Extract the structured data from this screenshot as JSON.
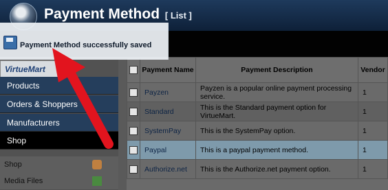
{
  "header": {
    "title": "Payment Method",
    "subtitle": "[ List ]"
  },
  "notification": {
    "message": "Payment Method successfully saved",
    "icon": "floppy-disk-icon"
  },
  "brand": {
    "logo_text": "VirtueMart"
  },
  "sidebar": {
    "menu": [
      "Products",
      "Orders & Shoppers",
      "Manufacturers",
      "Shop"
    ],
    "submenu": [
      {
        "label": "Shop",
        "icon": "shop-icon"
      },
      {
        "label": "Media Files",
        "icon": "media-files-icon"
      }
    ]
  },
  "table": {
    "headers": [
      "",
      "Payment Name",
      "Payment Description",
      "Vendor"
    ],
    "rows": [
      {
        "name": "Payzen",
        "description": "Payzen is a popular online payment processing service.",
        "vendor": "1"
      },
      {
        "name": "Standard",
        "description": "This is the Standard payment option for VirtueMart.",
        "vendor": "1"
      },
      {
        "name": "SystemPay",
        "description": "This is the SystemPay option.",
        "vendor": "1"
      },
      {
        "name": "Paypal",
        "description": "This is a paypal payment method.",
        "vendor": "1"
      },
      {
        "name": "Authorize.net",
        "description": "This is the Authorize.net payment option.",
        "vendor": "1"
      }
    ]
  },
  "annotation": {
    "arrow_color": "#e2141e"
  }
}
